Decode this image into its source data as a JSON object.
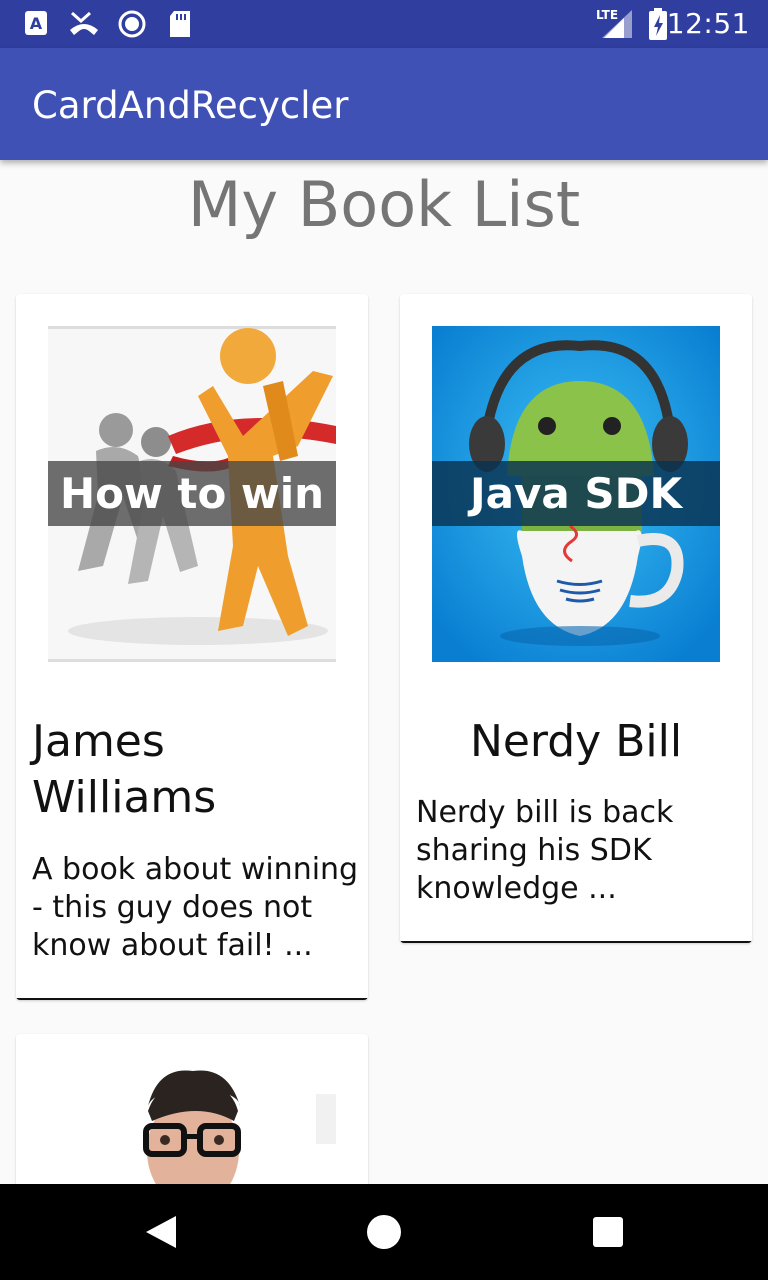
{
  "status_bar": {
    "time": "12:51",
    "network": "LTE",
    "icons": [
      "font-app-icon",
      "missed-call-icon",
      "radio-app-icon",
      "sd-card-icon",
      "signal-icon",
      "battery-charging-icon"
    ]
  },
  "app_bar": {
    "title": "CardAndRecycler"
  },
  "heading": "My Book List",
  "books": [
    {
      "cover_title": "How to win",
      "author": "James Williams",
      "description": "A book about winning - this guy does not know about fail! ..."
    },
    {
      "cover_title": "Java SDK",
      "author": "Nerdy Bill",
      "description": "Nerdy bill is back sharing his SDK knowledge ..."
    }
  ],
  "nav_bar": {
    "buttons": [
      "back-icon",
      "home-icon",
      "recents-icon"
    ]
  },
  "colors": {
    "status_bar": "#303F9F",
    "app_bar": "#3F51B5",
    "background": "#FAFAFA",
    "heading": "#757575"
  }
}
